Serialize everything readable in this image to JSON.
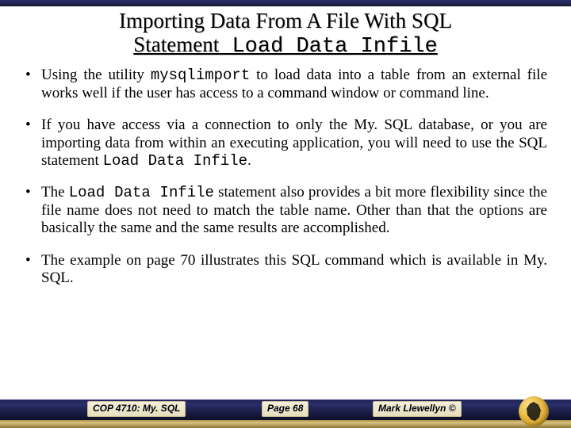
{
  "title": {
    "line1": "Importing Data From A File With SQL",
    "line2_plain": "Statement",
    "line2_code": " Load Data Infile"
  },
  "bullets": {
    "b1_pre": "Using the utility ",
    "b1_code": "mysqlimport",
    "b1_post": " to load data into a table from an external file works well if the user has access to a command window or command line.",
    "b2_pre": "If you have access via a connection to only the My. SQL database, or you are importing data from within an executing application, you will need to use the SQL statement ",
    "b2_code": "Load Data Infile",
    "b2_post": ".",
    "b3_pre": "The ",
    "b3_code": "Load Data Infile",
    "b3_post": " statement also provides a bit more flexibility since the file name does not need to match the table name.   Other than that the options are basically the same and the same results are accomplished.",
    "b4": "The example on page 70 illustrates this SQL command which is available in My. SQL."
  },
  "footer": {
    "course": "COP 4710: My. SQL",
    "page": "Page 68",
    "author": "Mark Llewellyn ©"
  }
}
